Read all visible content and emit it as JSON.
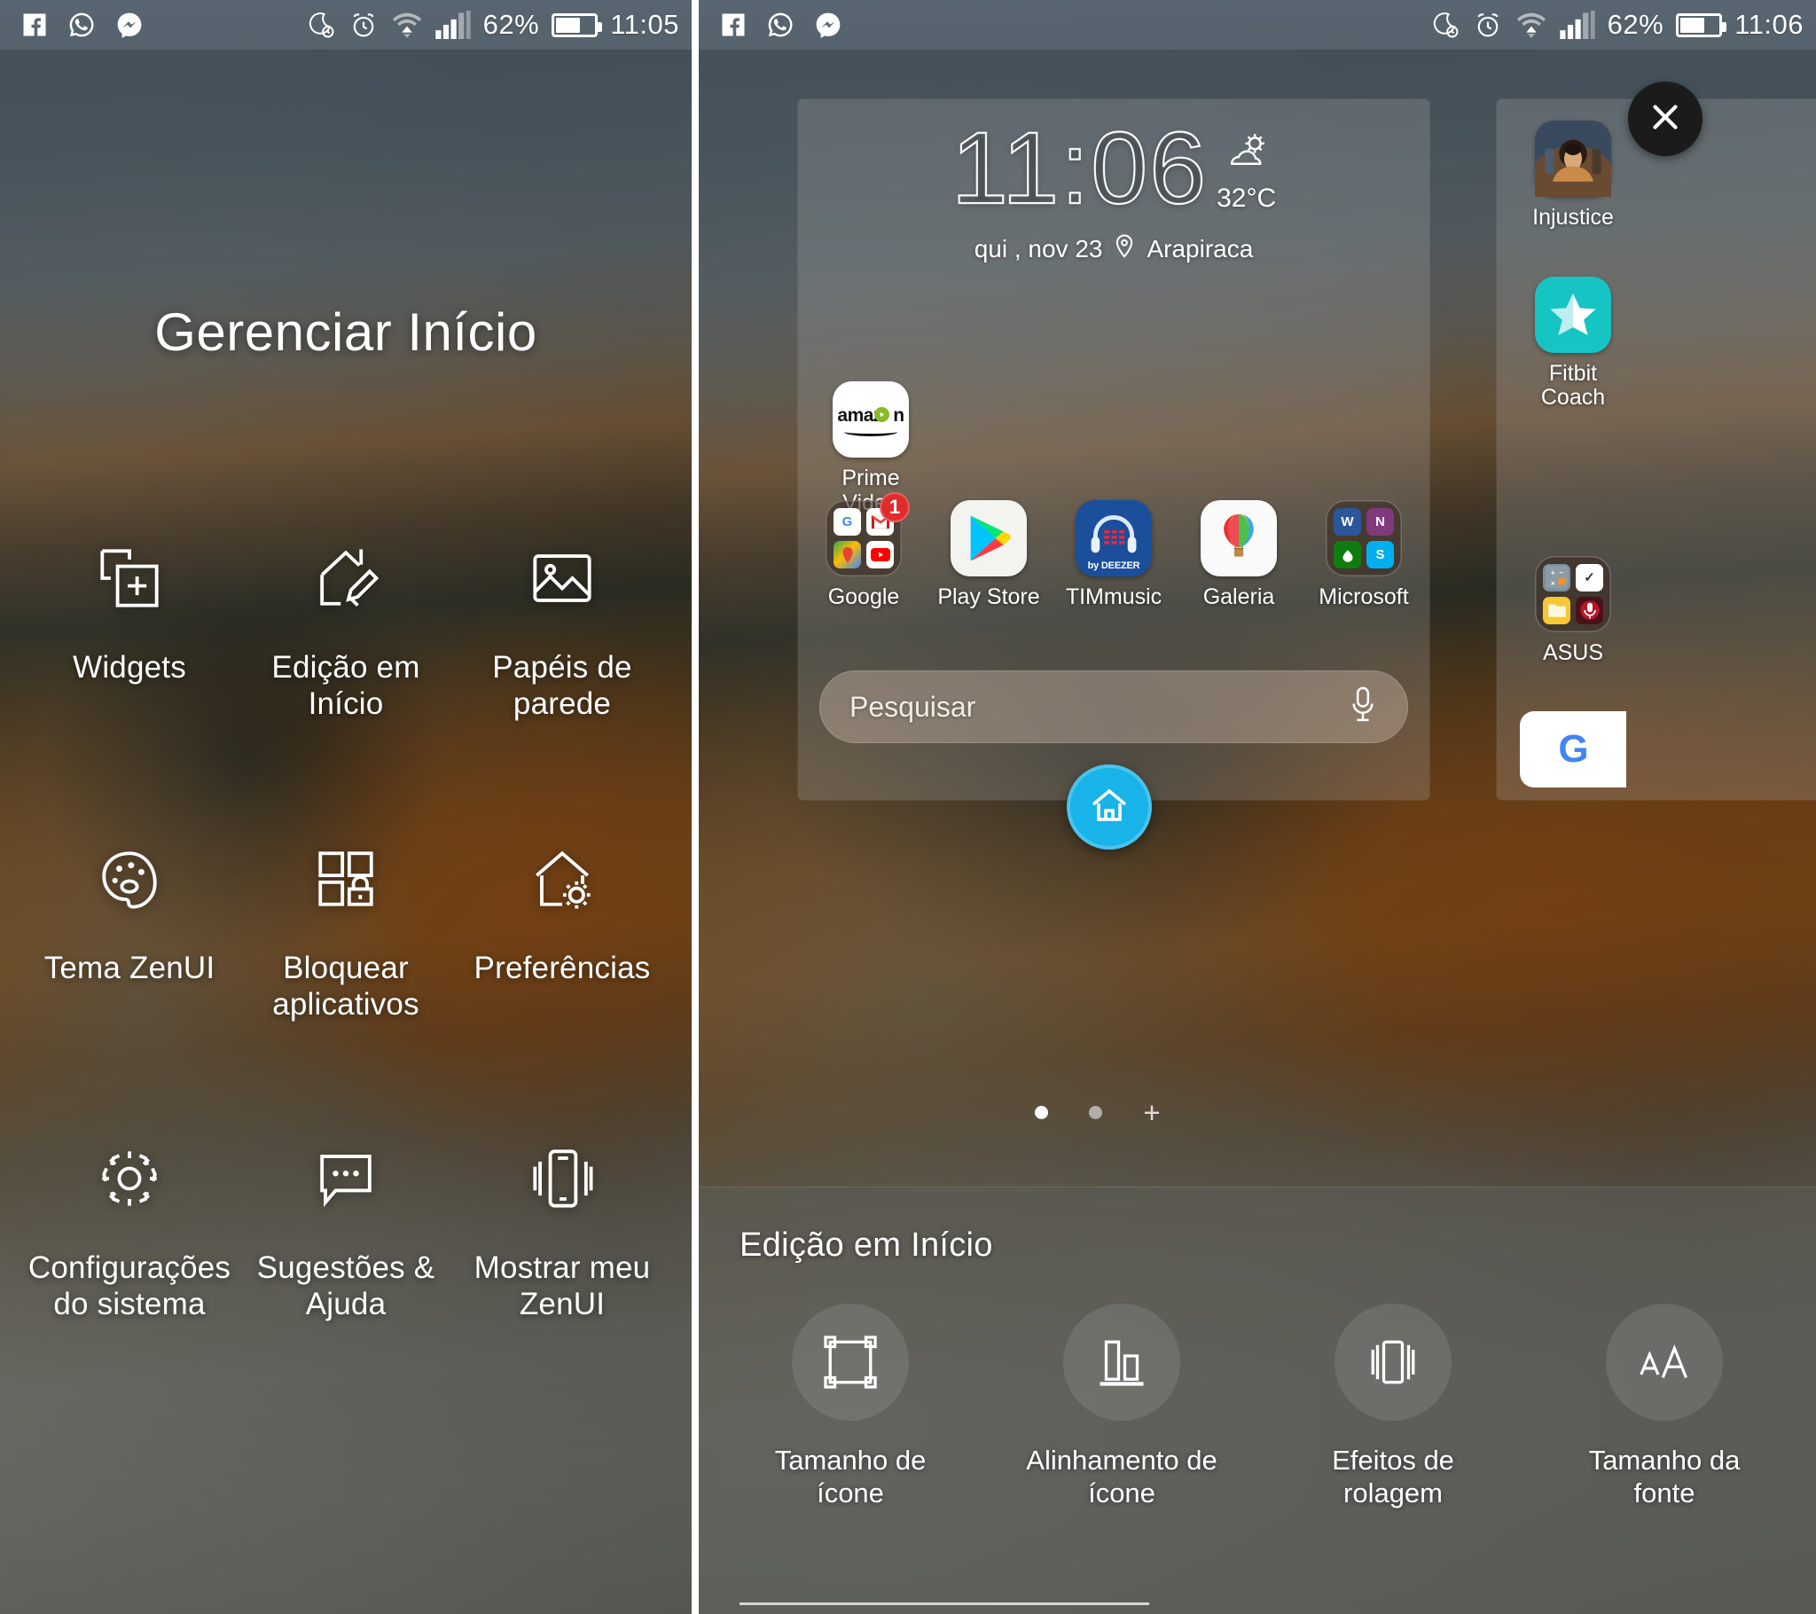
{
  "left_panel": {
    "statusbar": {
      "notif_icons": [
        "facebook-icon",
        "whatsapp-icon",
        "messenger-icon"
      ],
      "sys_icons": [
        "do-not-disturb-icon",
        "alarm-icon",
        "wifi-icon",
        "signal-icon"
      ],
      "battery_percent": "62%",
      "time": "11:05"
    },
    "title": "Gerenciar Início",
    "menu_items": [
      {
        "label": "Widgets",
        "icon": "widgets-add-icon"
      },
      {
        "label": "Edição em Início",
        "icon": "home-edit-pencil-icon"
      },
      {
        "label": "Papéis de parede",
        "icon": "wallpaper-image-icon"
      },
      {
        "label": "Tema ZenUI",
        "icon": "palette-icon"
      },
      {
        "label": "Bloquear aplicativos",
        "icon": "app-lock-icon"
      },
      {
        "label": "Preferências",
        "icon": "home-gear-icon"
      },
      {
        "label": "Configurações do sistema",
        "icon": "gear-icon"
      },
      {
        "label": "Sugestões & Ajuda",
        "icon": "chat-bubble-icon"
      },
      {
        "label": "Mostrar meu ZenUI",
        "icon": "phone-share-icon"
      }
    ]
  },
  "right_panel": {
    "statusbar": {
      "notif_icons": [
        "facebook-icon",
        "whatsapp-icon",
        "messenger-icon"
      ],
      "sys_icons": [
        "do-not-disturb-icon",
        "alarm-icon",
        "wifi-icon",
        "signal-icon"
      ],
      "battery_percent": "62%",
      "time": "11:06"
    },
    "close_button": "close-icon",
    "clock_widget": {
      "time": "11:06",
      "temperature": "32°C",
      "date": "qui , nov 23",
      "location": "Arapiraca",
      "weather_icon": "sun-behind-cloud-icon",
      "location_icon": "map-pin-icon"
    },
    "apps_single_row": [
      {
        "label": "Prime Video",
        "icon": "amazon-prime-video-icon"
      }
    ],
    "apps_row": [
      {
        "label": "Google",
        "icon": "folder-icon",
        "badge": "1",
        "folder_items": [
          "google-icon",
          "gmail-icon",
          "maps-icon",
          "youtube-icon"
        ]
      },
      {
        "label": "Play Store",
        "icon": "play-store-icon"
      },
      {
        "label": "TIMmusic",
        "icon": "timmusic-icon",
        "sub": "by DEEZER"
      },
      {
        "label": "Galeria",
        "icon": "gallery-balloon-icon"
      },
      {
        "label": "Microsoft",
        "icon": "folder-icon",
        "folder_items": [
          "word-icon",
          "onenote-icon",
          "xbox-icon",
          "skype-icon"
        ]
      }
    ],
    "peek_page_apps": [
      {
        "label": "Injustice",
        "icon": "injustice-game-icon"
      },
      {
        "label": "Fitbit Coach",
        "icon": "fitbit-star-icon"
      },
      {
        "label": "ASUS",
        "icon": "folder-icon",
        "folder_items": [
          "calculator-icon",
          "checklist-icon",
          "filemanager-icon",
          "recorder-icon"
        ]
      },
      {
        "label": "",
        "icon": "google-icon"
      }
    ],
    "search": {
      "placeholder": "Pesquisar",
      "mic_icon": "microphone-icon"
    },
    "home_fab": "home-icon",
    "page_dots": {
      "count": 2,
      "active_index": 0,
      "add_label": "+"
    },
    "bottom_sheet": {
      "title": "Edição em Início",
      "options": [
        {
          "label": "Tamanho de ícone",
          "icon": "resize-frame-icon"
        },
        {
          "label": "Alinhamento de ícone",
          "icon": "align-bars-icon"
        },
        {
          "label": "Efeitos de rolagem",
          "icon": "scroll-effect-icon"
        },
        {
          "label": "Tamanho da fonte",
          "icon": "font-size-icon"
        }
      ]
    }
  },
  "colors": {
    "accent_blue": "#18b3e8",
    "badge_red": "#e02c2c",
    "fitbit_teal": "#17c4c4"
  }
}
